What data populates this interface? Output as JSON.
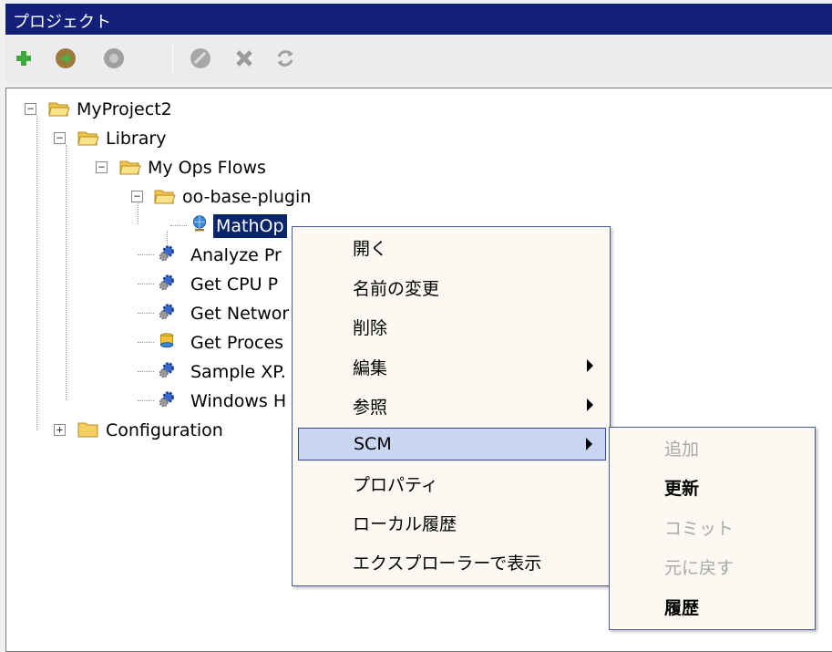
{
  "panel": {
    "title": "プロジェクト"
  },
  "toolbar": {
    "buttons": [
      {
        "icon": "add-icon"
      },
      {
        "icon": "import-icon"
      },
      {
        "icon": "package-icon"
      },
      {
        "icon": "edit-icon"
      },
      {
        "icon": "delete-icon"
      },
      {
        "icon": "refresh-icon"
      }
    ]
  },
  "tree": {
    "root": "MyProject2",
    "library": "Library",
    "my_ops_flows": "My Ops Flows",
    "oo_base_plugin": "oo-base-plugin",
    "mathops": "MathOp",
    "flows": [
      "Analyze Pr",
      "Get CPU P",
      "Get Networ",
      "Get Proces",
      "Sample XP.",
      "Windows H"
    ],
    "configuration": "Configuration"
  },
  "context_menu": {
    "items": [
      "開く",
      "名前の変更",
      "削除",
      "編集",
      "参照",
      "SCM",
      "プロパティ",
      "ローカル履歴",
      "エクスプローラーで表示"
    ],
    "highlighted": "SCM"
  },
  "scm_submenu": {
    "items": [
      {
        "label": "追加",
        "enabled": false
      },
      {
        "label": "更新",
        "enabled": true
      },
      {
        "label": "コミット",
        "enabled": false
      },
      {
        "label": "元に戻す",
        "enabled": false
      },
      {
        "label": "履歴",
        "enabled": true
      }
    ]
  },
  "colors": {
    "titlebar": "#12207a",
    "selection": "#0a246a",
    "menu_bg": "#fbf9f1",
    "menu_hover": "#c9d6f2"
  }
}
